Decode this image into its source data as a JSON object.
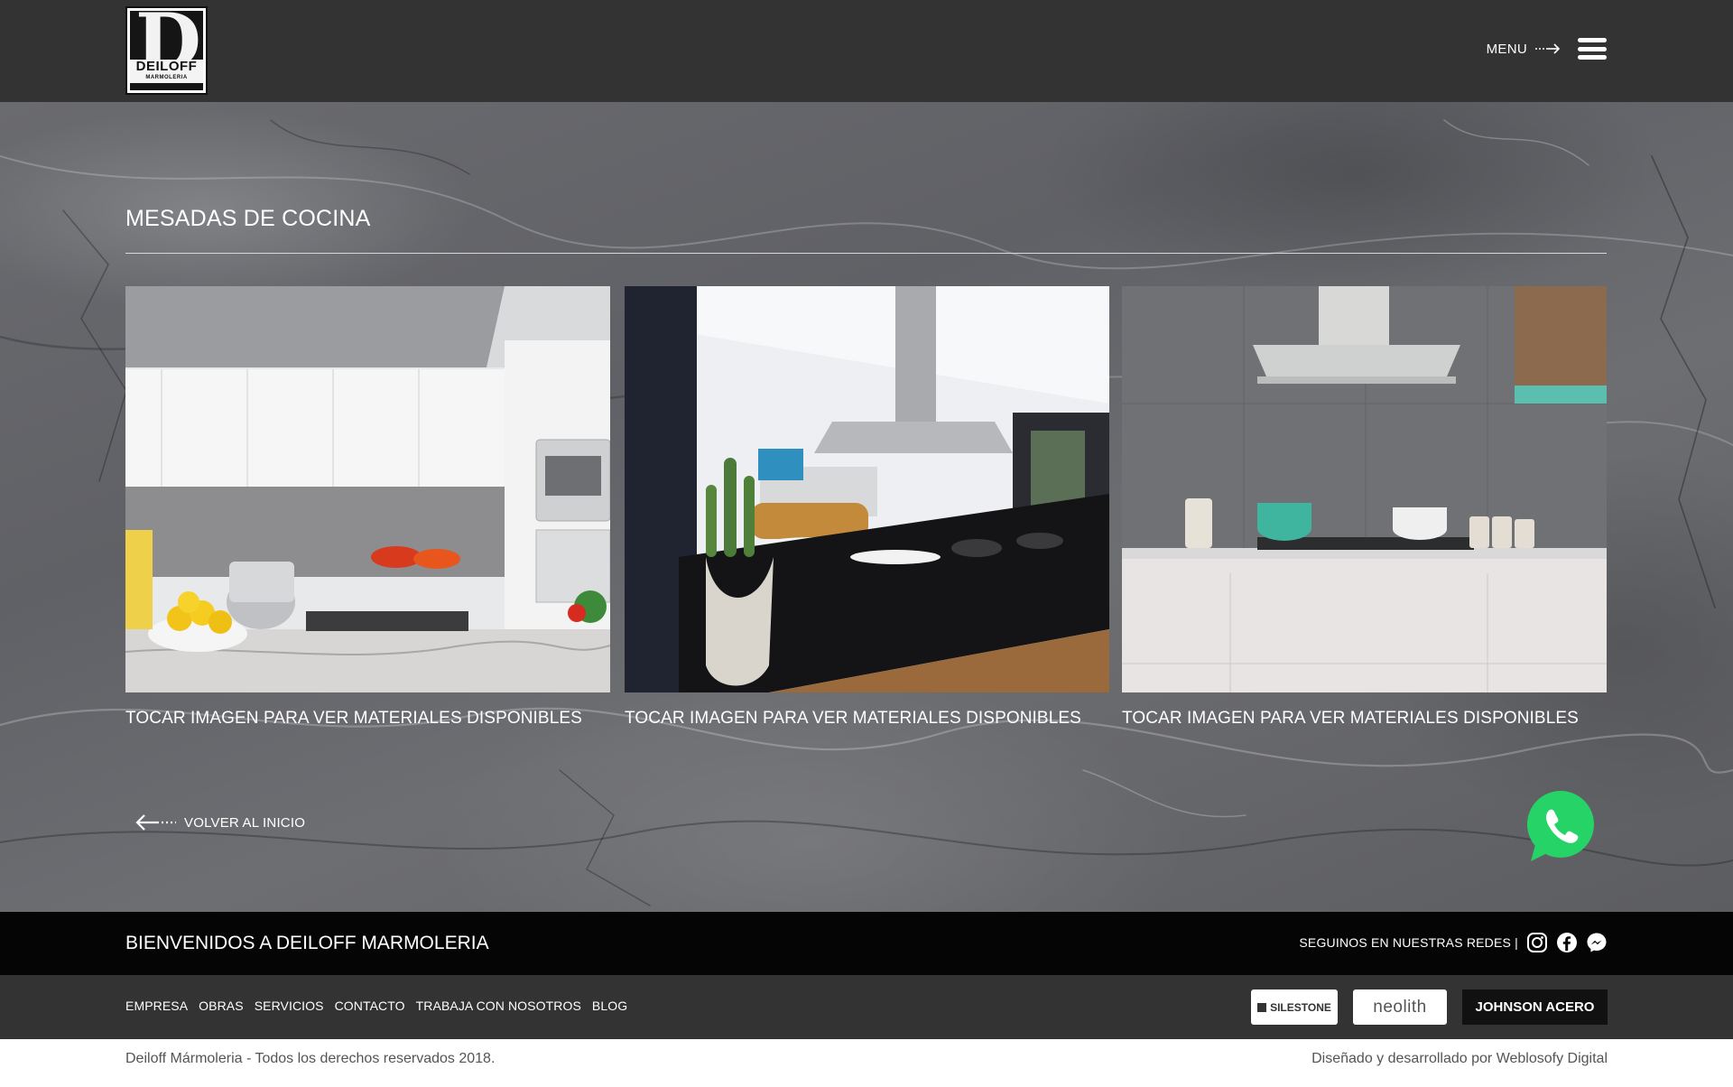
{
  "header": {
    "logo_text": "DEILOFF",
    "logo_subtext": "MARMOLERIA",
    "menu_label": "MENU"
  },
  "main": {
    "section_title": "MESADAS DE COCINA",
    "cards": [
      {
        "caption": "TOCAR IMAGEN PARA VER MATERIALES DISPONIBLES",
        "image": "kitchen-white-cabinets-photo"
      },
      {
        "caption": "TOCAR IMAGEN PARA VER MATERIALES DISPONIBLES",
        "image": "kitchen-island-black-countertop-photo"
      },
      {
        "caption": "TOCAR IMAGEN PARA VER MATERIALES DISPONIBLES",
        "image": "kitchen-grey-tiles-hood-photo"
      }
    ],
    "back_label": "VOLVER AL INICIO",
    "whatsapp_icon": "whatsapp-icon",
    "whatsapp_color": "#25d366"
  },
  "footer": {
    "welcome": "BIENVENIDOS A DEILOFF MARMOLERIA",
    "social_label": "SEGUINOS EN NUESTRAS REDES |",
    "social_icons": [
      "instagram-icon",
      "facebook-icon",
      "messenger-icon"
    ],
    "nav": [
      "EMPRESA",
      "OBRAS",
      "SERVICIOS",
      "CONTACTO",
      "TRABAJA CON NOSOTROS",
      "BLOG"
    ],
    "brands": {
      "silestone": "SILESTONE",
      "neolith": "neolith",
      "johnson": "JOHNSON ACERO"
    },
    "copyright": "Deiloff Mármoleria - Todos los derechos reservados 2018.",
    "credits": "Diseñado y desarrollado por Weblosofy Digital"
  },
  "colors": {
    "header_bg": "#333333",
    "footer_top_bg": "#050505",
    "footer_nav_bg": "#333333",
    "copyright_bg": "#ffffff"
  }
}
